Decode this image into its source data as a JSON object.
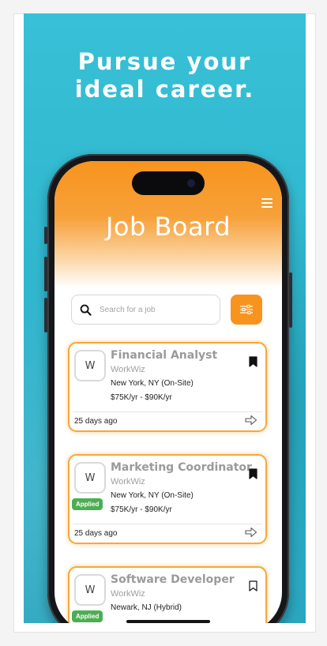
{
  "headline": [
    "Pursue your",
    "ideal career."
  ],
  "app": {
    "title": "Job Board",
    "search_placeholder": "Search for a job"
  },
  "colors": {
    "background": "#37c0d6",
    "accent": "#f7941d",
    "applied": "#4cae52"
  },
  "jobs": [
    {
      "logo": "W",
      "title": "Financial Analyst",
      "company": "WorkWiz",
      "location": "New York, NY (On-Site)",
      "salary": "$75K/yr - $90K/yr",
      "posted": "25 days ago",
      "bookmarked": true,
      "applied": false
    },
    {
      "logo": "W",
      "title": "Marketing Coordinator",
      "company": "WorkWiz",
      "location": "New York, NY (On-Site)",
      "salary": "$75K/yr - $90K/yr",
      "posted": "25 days ago",
      "bookmarked": true,
      "applied": true,
      "applied_label": "Applied"
    },
    {
      "logo": "W",
      "title": "Software Developer",
      "company": "WorkWiz",
      "location": "Newark, NJ (Hybrid)",
      "bookmarked": false,
      "applied": true,
      "applied_label": "Applied"
    }
  ]
}
